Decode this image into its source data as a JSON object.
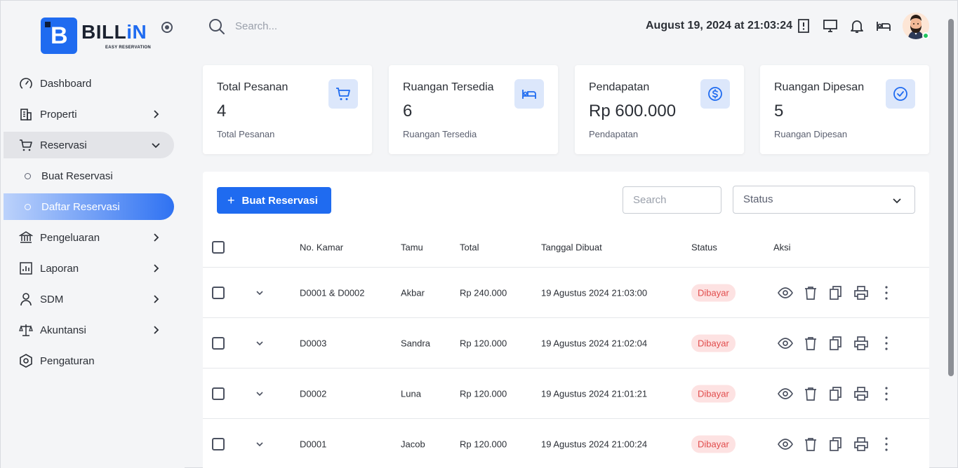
{
  "brand": {
    "name_main": "BILL",
    "name_accent": "iN",
    "tagline": "EASY RESERVATION"
  },
  "header": {
    "search_placeholder": "Search...",
    "datetime": "August 19, 2024 at 21:03:24"
  },
  "sidebar": {
    "items": [
      {
        "label": "Dashboard",
        "icon": "dashboard-gauge-icon"
      },
      {
        "label": "Properti",
        "icon": "building-icon"
      },
      {
        "label": "Reservasi",
        "icon": "cart-icon"
      },
      {
        "label": "Buat Reservasi"
      },
      {
        "label": "Daftar Reservasi"
      },
      {
        "label": "Pengeluaran",
        "icon": "bank-icon"
      },
      {
        "label": "Laporan",
        "icon": "report-chart-icon"
      },
      {
        "label": "SDM",
        "icon": "user-icon"
      },
      {
        "label": "Akuntansi",
        "icon": "scale-icon"
      },
      {
        "label": "Pengaturan",
        "icon": "settings-hex-icon"
      }
    ]
  },
  "stats": [
    {
      "title": "Total Pesanan",
      "value": "4",
      "subtitle": "Total Pesanan",
      "icon": "cart-icon"
    },
    {
      "title": "Ruangan Tersedia",
      "value": "6",
      "subtitle": "Ruangan Tersedia",
      "icon": "bed-icon"
    },
    {
      "title": "Pendapatan",
      "value": "Rp 600.000",
      "subtitle": "Pendapatan",
      "icon": "dollar-circle-icon"
    },
    {
      "title": "Ruangan Dipesan",
      "value": "5",
      "subtitle": "Ruangan Dipesan",
      "icon": "check-circle-icon"
    }
  ],
  "table": {
    "add_button": "Buat Reservasi",
    "search_placeholder": "Search",
    "status_filter": "Status",
    "columns": {
      "room": "No. Kamar",
      "guest": "Tamu",
      "total": "Total",
      "created": "Tanggal Dibuat",
      "status": "Status",
      "actions": "Aksi"
    },
    "rows": [
      {
        "room": "D0001 & D0002",
        "guest": "Akbar",
        "total": "Rp 240.000",
        "created": "19 Agustus 2024 21:03:00",
        "status": "Dibayar"
      },
      {
        "room": "D0003",
        "guest": "Sandra",
        "total": "Rp 120.000",
        "created": "19 Agustus 2024 21:02:04",
        "status": "Dibayar"
      },
      {
        "room": "D0002",
        "guest": "Luna",
        "total": "Rp 120.000",
        "created": "19 Agustus 2024 21:01:21",
        "status": "Dibayar"
      },
      {
        "room": "D0001",
        "guest": "Jacob",
        "total": "Rp 120.000",
        "created": "19 Agustus 2024 21:00:24",
        "status": "Dibayar"
      }
    ]
  },
  "colors": {
    "primary": "#1f6bf0",
    "badge_bg": "#fde2e2",
    "badge_text": "#e14c4c"
  }
}
